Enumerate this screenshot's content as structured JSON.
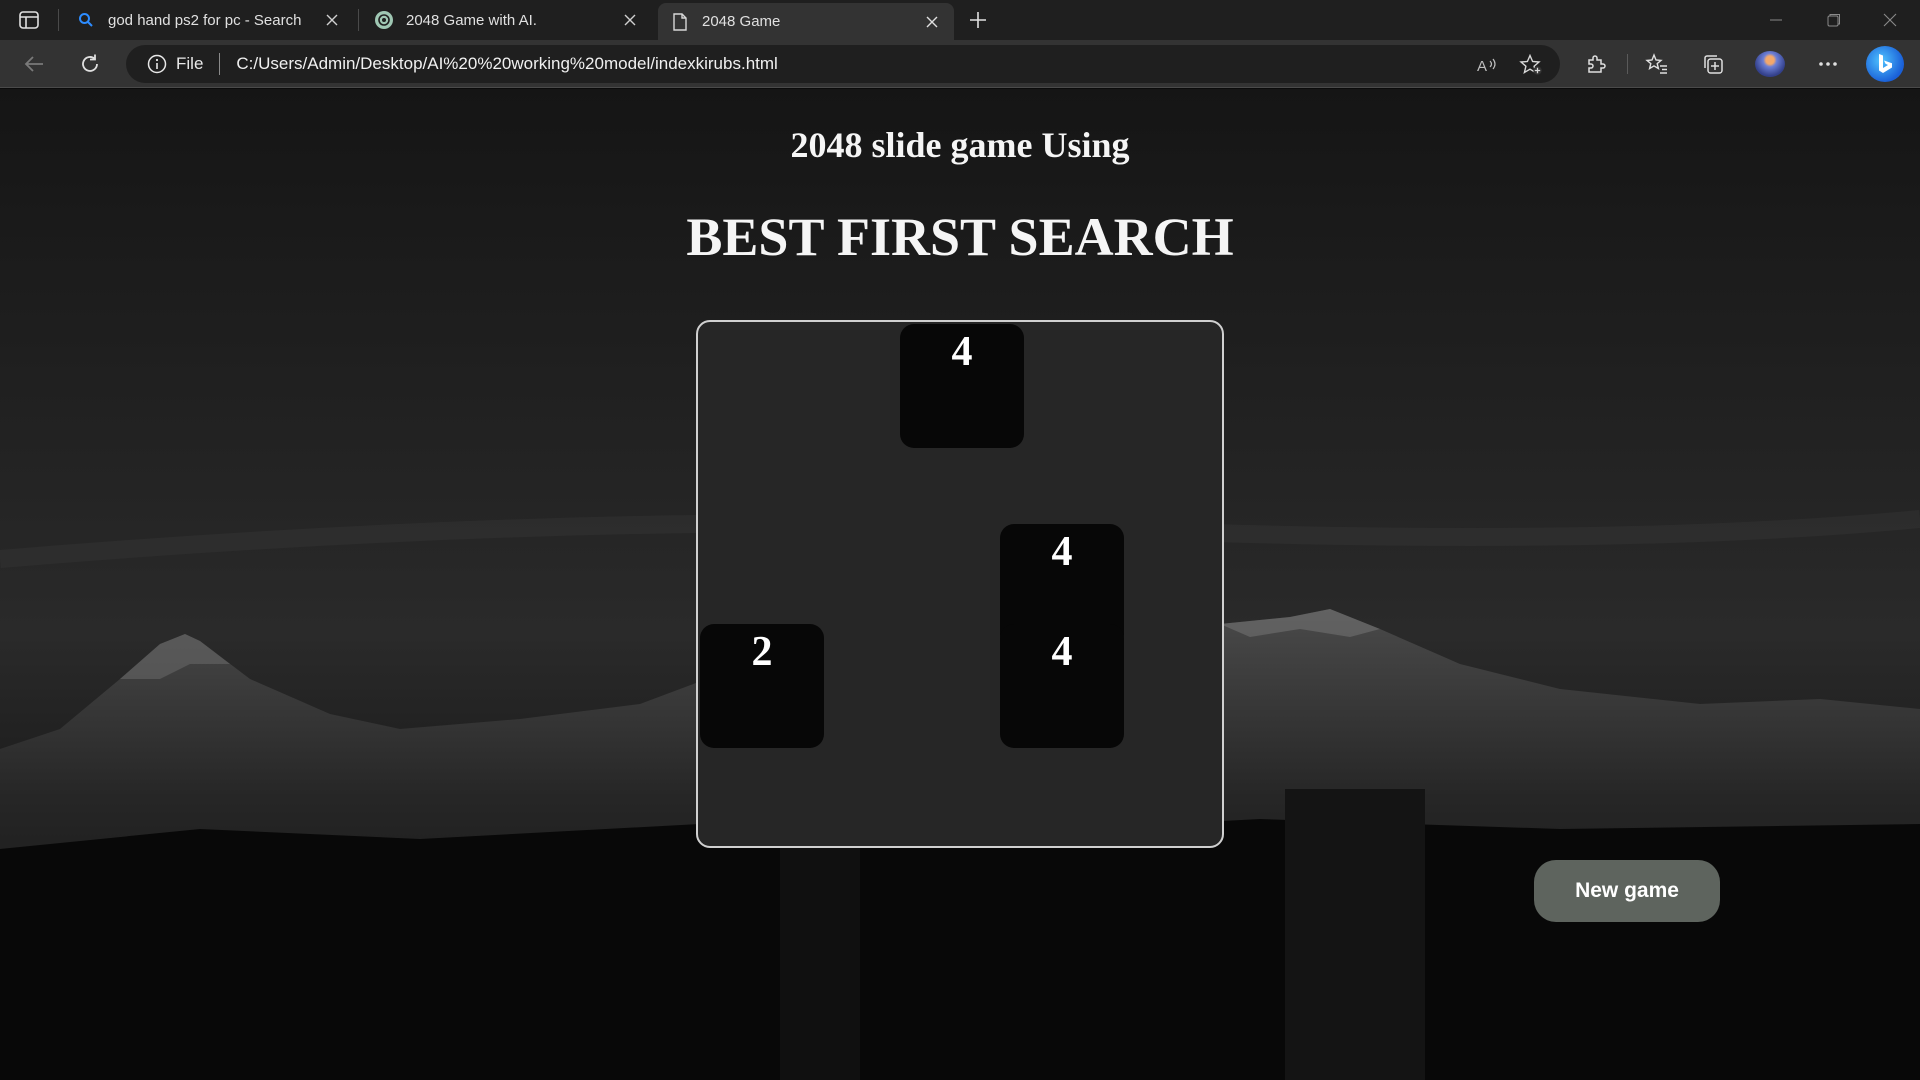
{
  "browser": {
    "tabs": [
      {
        "title": "god hand ps2 for pc - Search",
        "icon": "search-icon"
      },
      {
        "title": "2048 Game with AI.",
        "icon": "chatgpt-icon"
      },
      {
        "title": "2048 Game",
        "icon": "page-icon"
      }
    ],
    "address": {
      "scheme_label": "File",
      "url": "C:/Users/Admin/Desktop/AI%20%20working%20model/indexkirubs.html"
    },
    "colors": {
      "tabbar": "#1f1f1f",
      "toolbar": "#333333",
      "accent": "#1a60d8"
    }
  },
  "page": {
    "title_line1": "2048 slide game Using",
    "title_line2": "BEST FIRST SEARCH",
    "new_game_label": "New game",
    "board": {
      "size": 4,
      "tiles": [
        {
          "row": 0,
          "col": 2,
          "value": "4"
        },
        {
          "row": 2,
          "col": 3,
          "value": "4"
        },
        {
          "row": 3,
          "col": 0,
          "value": "2"
        },
        {
          "row": 3,
          "col": 3,
          "value": "4"
        }
      ]
    },
    "colors": {
      "board": "#262626",
      "tile": "#070707",
      "button": "#5e645e"
    }
  }
}
